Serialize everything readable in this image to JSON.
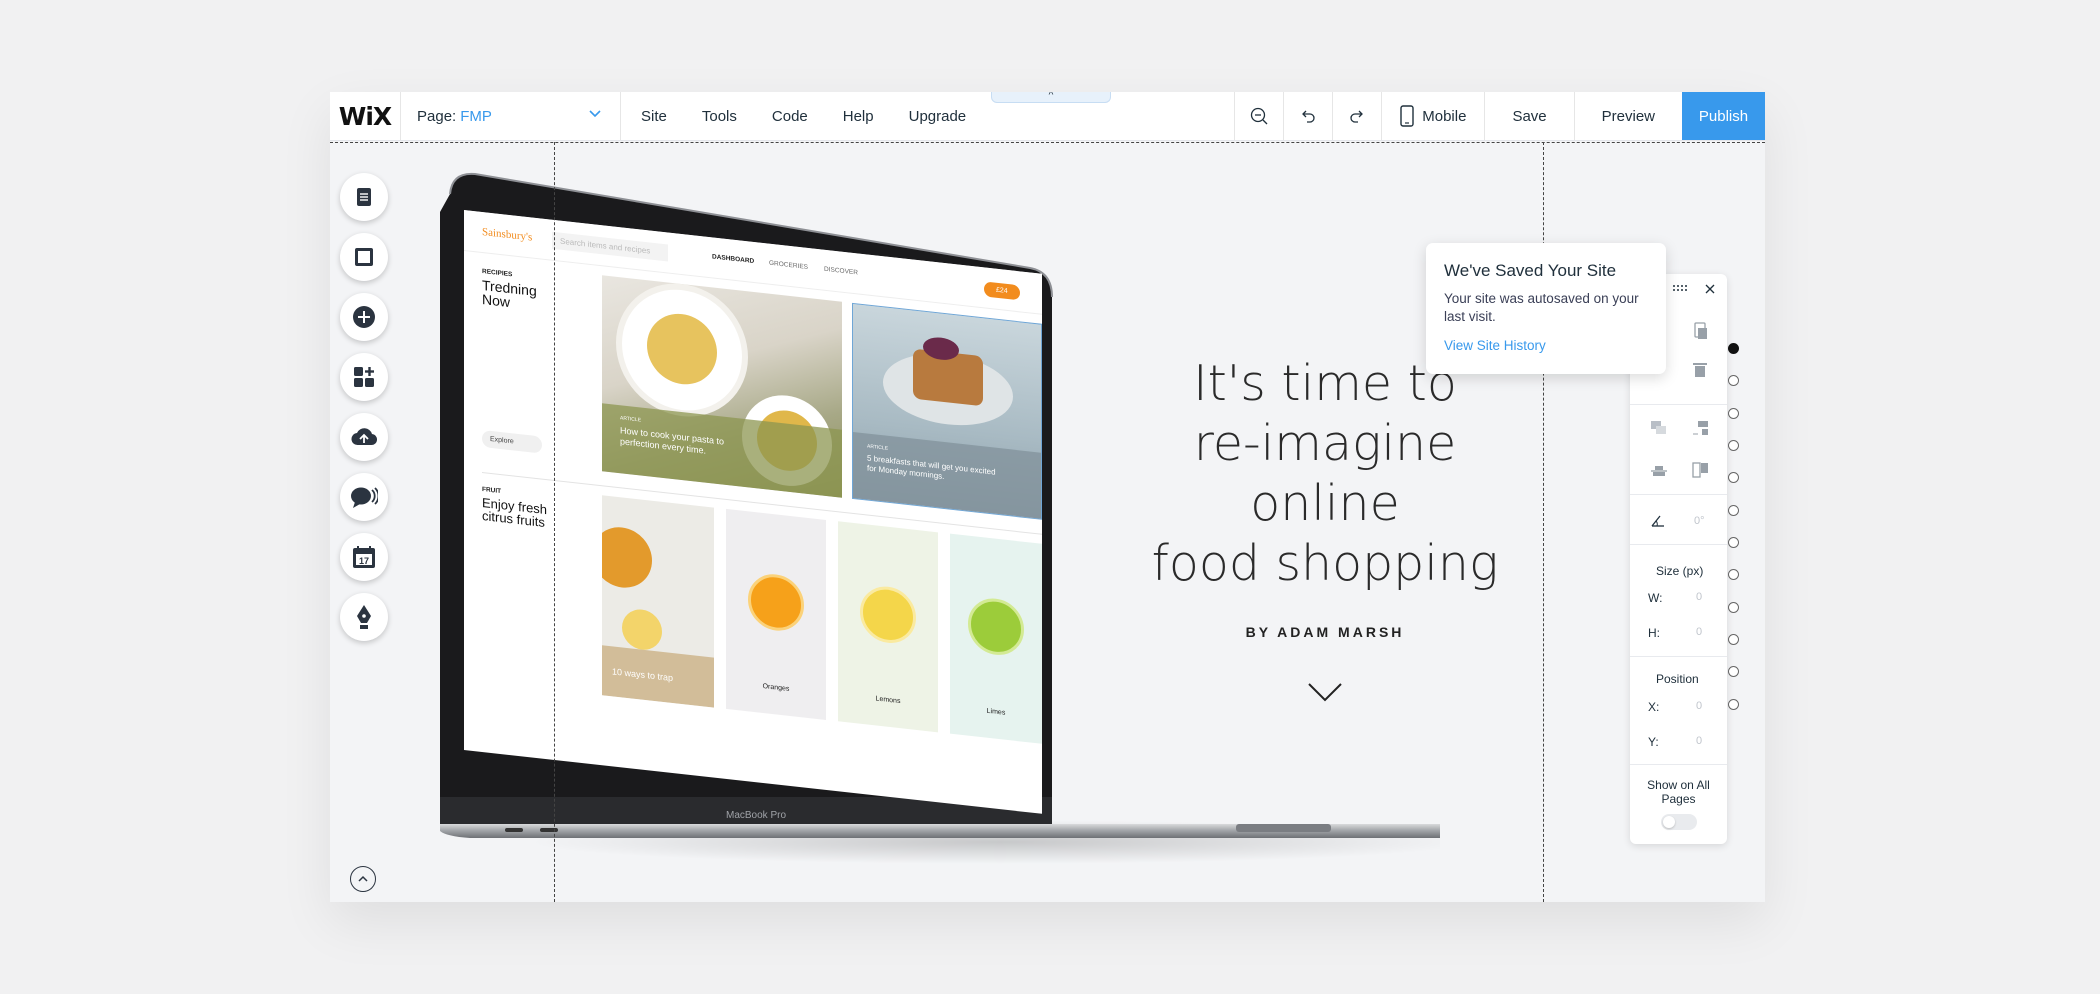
{
  "topbar": {
    "logo": "WiX",
    "page_label": "Page:",
    "page_name": "FMP",
    "menu": [
      "Site",
      "Tools",
      "Code",
      "Help",
      "Upgrade"
    ],
    "mobile_label": "Mobile",
    "save_label": "Save",
    "preview_label": "Preview",
    "publish_label": "Publish",
    "pull_tab_glyph": "^"
  },
  "left_toolbar": {
    "icons": [
      "pages-icon",
      "background-icon",
      "add-icon",
      "apps-icon",
      "upload-icon",
      "chat-icon",
      "calendar-icon",
      "pen-icon"
    ],
    "calendar_day": "17"
  },
  "hero": {
    "title": "It's time to\nre-imagine online\nfood shopping",
    "byline": "BY ADAM MARSH"
  },
  "saved_tooltip": {
    "title": "We've Saved Your Site",
    "description": "Your site was autosaved on your last visit.",
    "link": "View Site History"
  },
  "right_panel": {
    "rotation": "0°",
    "size_heading": "Size (px)",
    "w_label": "W:",
    "w_value": "0",
    "h_label": "H:",
    "h_value": "0",
    "position_heading": "Position",
    "x_label": "X:",
    "x_value": "0",
    "y_label": "Y:",
    "y_value": "0",
    "show_all_pages": "Show on All Pages"
  },
  "laptop_site": {
    "brand": "Sainsbury's",
    "search_placeholder": "Search items and recipes",
    "nav": [
      "DASHBOARD",
      "GROCERIES",
      "DISCOVER"
    ],
    "cart": "£24",
    "recipes_label": "RECIPIES",
    "recipes_heading": "Tredning Now",
    "explore": "Explore",
    "article_tag": "ARTICLE",
    "article1": "How to cook your pasta to perfection every time.",
    "article2": "5 breakfasts that will get you excited for Monday mornings.",
    "fruit_label": "FRUIT",
    "fruit_heading": "Enjoy fresh citrus fruits",
    "article3": "10 ways to trap",
    "fruits": [
      "Oranges",
      "Lemons",
      "Limes"
    ],
    "laptop_model": "MacBook Pro"
  },
  "colors": {
    "accent": "#3899ec",
    "brand_orange": "#f28c1e"
  }
}
